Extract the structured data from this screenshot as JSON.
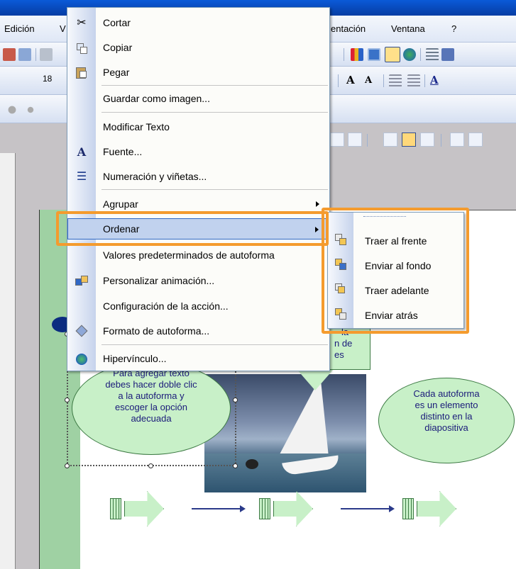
{
  "menubar": {
    "items": [
      "Edición",
      "Ver",
      "Presentación",
      "Ventana",
      "?"
    ],
    "visible_fragments": {
      "edicion": "Edición",
      "v": "V",
      "presentacion": "entación",
      "ventana": "Ventana",
      "help": "?"
    }
  },
  "toolbar": {
    "font_size": "18",
    "bold_a": "A",
    "grow_a": "A",
    "color_a": "A"
  },
  "context_menu": {
    "items": [
      {
        "label": "Cortar",
        "icon": "scissors-icon",
        "has_submenu": false
      },
      {
        "label": "Copiar",
        "icon": "copy-icon",
        "has_submenu": false
      },
      {
        "label": "Pegar",
        "icon": "paste-icon",
        "has_submenu": false
      },
      {
        "label": "Guardar como imagen...",
        "icon": "",
        "has_submenu": false
      },
      {
        "label": "Modificar Texto",
        "icon": "",
        "has_submenu": false
      },
      {
        "label": "Fuente...",
        "icon": "font-icon",
        "has_submenu": false
      },
      {
        "label": "Numeración y viñetas...",
        "icon": "list-icon",
        "has_submenu": false
      },
      {
        "label": "Agrupar",
        "icon": "",
        "has_submenu": true
      },
      {
        "label": "Ordenar",
        "icon": "",
        "has_submenu": true,
        "highlighted": true
      },
      {
        "label": "Valores predeterminados de autoforma",
        "icon": "",
        "has_submenu": false
      },
      {
        "label": "Personalizar animación...",
        "icon": "animation-icon",
        "has_submenu": false
      },
      {
        "label": "Configuración de la acción...",
        "icon": "",
        "has_submenu": false
      },
      {
        "label": "Formato de autoforma...",
        "icon": "paint-bucket-icon",
        "has_submenu": false
      },
      {
        "label": "Hipervínculo...",
        "icon": "globe-link-icon",
        "has_submenu": false
      }
    ]
  },
  "submenu": {
    "items": [
      {
        "label": "Traer al frente",
        "icon": "bring-to-front-icon"
      },
      {
        "label": "Enviar al fondo",
        "icon": "send-to-back-icon"
      },
      {
        "label": "Traer adelante",
        "icon": "bring-forward-icon"
      },
      {
        "label": "Enviar atrás",
        "icon": "send-backward-icon"
      }
    ]
  },
  "slide": {
    "callout_left": [
      "Para agregar texto",
      "debes hacer doble clic",
      "a la autoforma y",
      "escoger la opción",
      "adecuada"
    ],
    "callout_right": [
      "Cada autoforma",
      "es un elemento",
      "distinto en la",
      "diapositiva"
    ],
    "callout_top": [
      "la",
      "n de",
      "es"
    ]
  },
  "colors": {
    "highlight_box": "#f49b2e",
    "menu_hover": "#c1d2ee",
    "callout_fill": "#c8f0c8",
    "callout_text": "#1a1a7a",
    "slide_band": "#9fd1a3"
  }
}
